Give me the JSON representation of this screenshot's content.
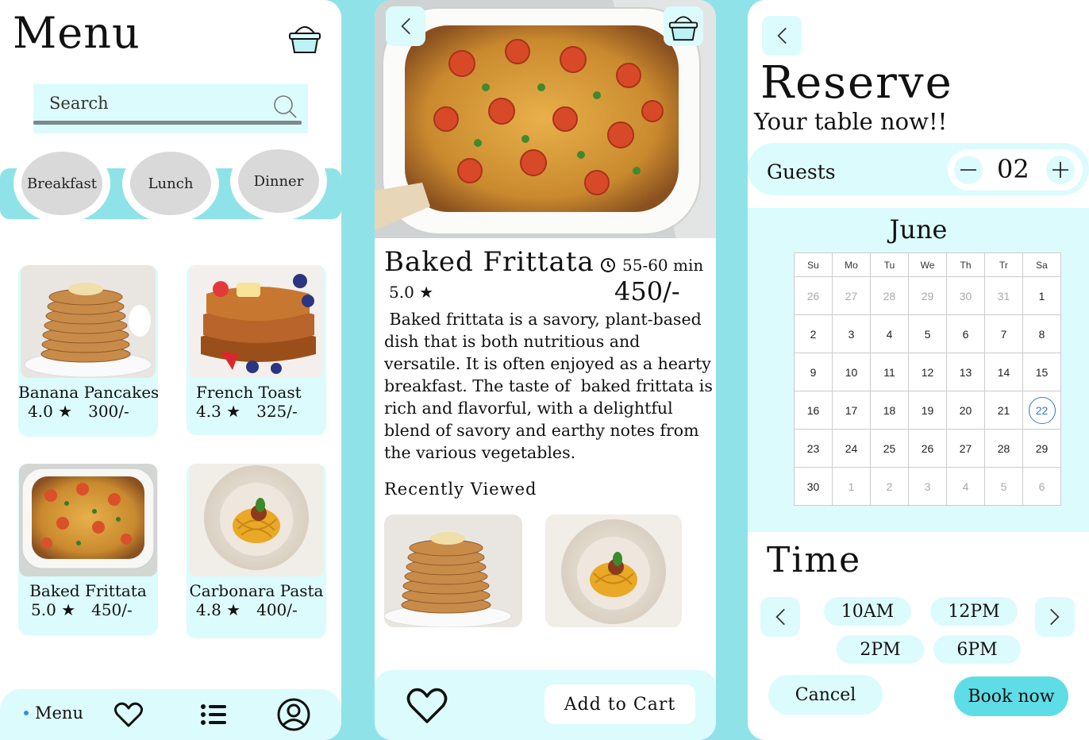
{
  "menu_screen": {
    "title": "Menu",
    "basket_icon": "basket-icon",
    "search": {
      "placeholder": "Search",
      "icon": "search-icon"
    },
    "categories": [
      "Breakfast",
      "Lunch",
      "Dinner"
    ],
    "items": [
      {
        "name": "Banana Pancakes",
        "rating": "4.0 ★",
        "price": "300/-"
      },
      {
        "name": "French Toast",
        "rating": "4.3 ★",
        "price": "325/-"
      },
      {
        "name": "Baked Frittata",
        "rating": "5.0 ★",
        "price": "450/-"
      },
      {
        "name": "Carbonara Pasta",
        "rating": "4.8 ★",
        "price": "400/-"
      }
    ],
    "nav": {
      "menu_label": "Menu",
      "icons": [
        "heart-icon",
        "list-icon",
        "profile-icon"
      ]
    }
  },
  "detail_screen": {
    "title": "Baked Frittata",
    "rating": "5.0 ★",
    "time": "55-60 min",
    "price": "450/-",
    "description": " Baked frittata is a savory, plant-based dish that is both nutritious and versatile. It is often enjoyed as a hearty breakfast. The taste of  baked frittata is rich and flavorful, with a delightful blend of savory and earthy notes from the various vegetables.",
    "recently_viewed_title": "Recently Viewed",
    "add_to_cart_label": "Add to Cart"
  },
  "reserve_screen": {
    "title": "Reserve",
    "subtitle": "Your table now!!",
    "guests_label": "Guests",
    "guests_count": "02",
    "month": "June",
    "weekdays": [
      "Su",
      "Mo",
      "Tu",
      "We",
      "Th",
      "Tr",
      "Sa"
    ],
    "weeks": [
      [
        "26",
        "27",
        "28",
        "29",
        "30",
        "31",
        "1"
      ],
      [
        "2",
        "3",
        "4",
        "5",
        "6",
        "7",
        "8"
      ],
      [
        "9",
        "10",
        "11",
        "12",
        "13",
        "14",
        "15"
      ],
      [
        "16",
        "17",
        "18",
        "19",
        "20",
        "21",
        "22"
      ],
      [
        "23",
        "24",
        "25",
        "26",
        "27",
        "28",
        "29"
      ],
      [
        "30",
        "1",
        "2",
        "3",
        "4",
        "5",
        "6"
      ]
    ],
    "selected_day": "22",
    "time_title": "Time",
    "slots": [
      "10AM",
      "12PM",
      "2PM",
      "6PM"
    ],
    "cancel_label": "Cancel",
    "book_label": "Book now"
  },
  "colors": {
    "accent": "#8fe3e8",
    "light": "#dcfbfd",
    "book_button": "#5fdde6",
    "selected_date": "#3b78d6"
  }
}
